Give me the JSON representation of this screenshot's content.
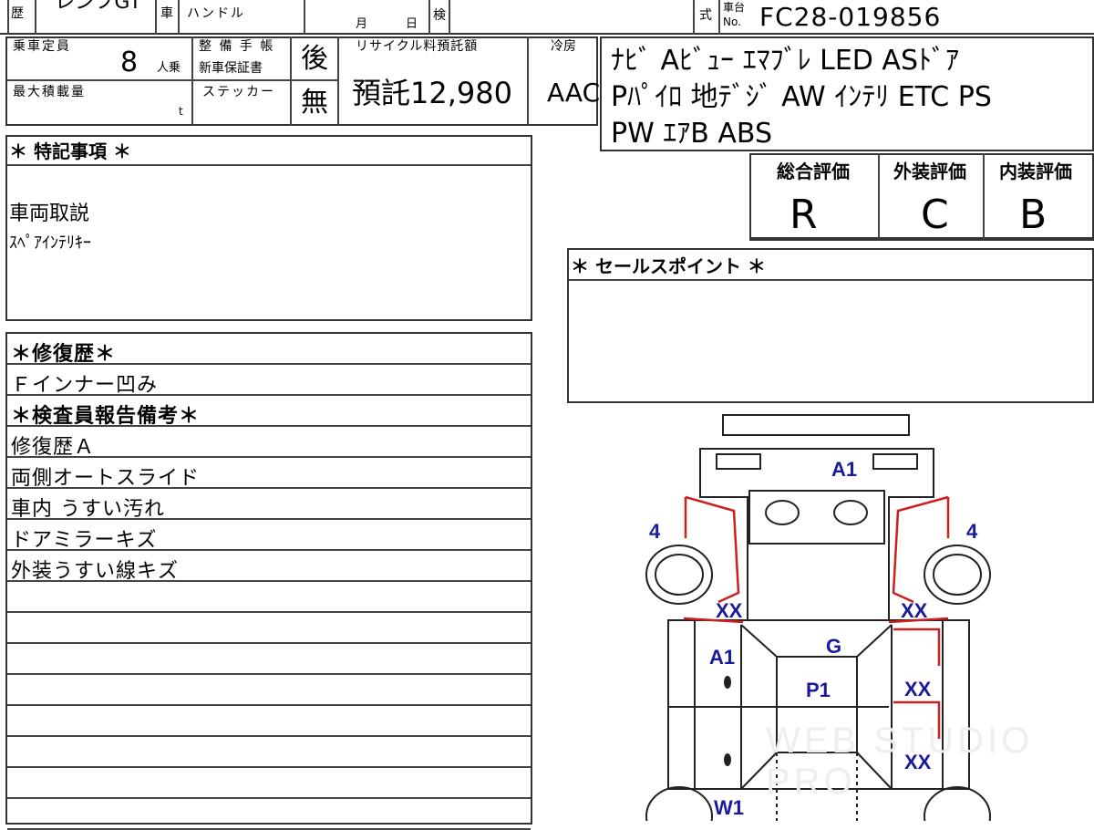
{
  "header": {
    "top_left_fragment": "歴",
    "model_fragment": "レンフGT",
    "car_label": "車",
    "handle_label": "ハンドル",
    "month_label": "月",
    "day_label": "日",
    "inspection_label": "検",
    "type_label": "式",
    "chassis_label_top": "車台",
    "chassis_label_bottom": "No.",
    "chassis_no": "FC28-019856"
  },
  "specs": {
    "capacity_label": "乗車定員",
    "capacity_value": "8",
    "capacity_unit": "人乗",
    "maxload_label": "最大積載量",
    "maxload_unit": "t",
    "maintenance_label": "整 備 手 帳",
    "warranty_label": "新車保証書",
    "sticker_label": "ステッカー",
    "maintenance_value": "後",
    "sticker_value": "無",
    "recycle_label": "リサイクル料預託額",
    "recycle_value": "預託12,980",
    "cooling_label": "冷房",
    "cooling_value": "AAC"
  },
  "equipment": {
    "line1": "ﾅﾋﾞ Aﾋﾞｭｰ ｴﾏﾌﾞﾚ LED ASﾄﾞｱ",
    "line2": "Pﾊﾟｲﾛ 地ﾃﾞｼﾞ AW ｲﾝﾃﾘ ETC PS",
    "line3": "PW ｴｱB ABS"
  },
  "grades": {
    "overall_label": "総合評価",
    "exterior_label": "外装評価",
    "interior_label": "内装評価",
    "overall": "R",
    "exterior": "C",
    "interior": "B"
  },
  "special_notes": {
    "title": "＊ 特記事項 ＊",
    "line1": "車両取説",
    "line2": "ｽﾍﾟｱｲﾝﾃﾘｷｰ"
  },
  "sales_points": {
    "title": "＊ セールスポイント ＊"
  },
  "history": {
    "repair_title": "＊修復歴＊",
    "repair_item": "Ｆインナー凹み",
    "inspector_title": "＊検査員報告備考＊",
    "items": [
      "修復歴Ａ",
      "両側オートスライド",
      "車内 うすい汚れ",
      "ドアミラーキズ",
      "外装うすい線キズ"
    ]
  },
  "diagram_marks": {
    "a1_top": "A1",
    "four_left": "4",
    "four_right": "4",
    "xx_left": "XX",
    "xx_right": "XX",
    "a1_side": "A1",
    "g": "G",
    "p1": "P1",
    "xx_door1": "XX",
    "xx_door2": "XX",
    "w1": "W1"
  },
  "colors": {
    "repair_red": "#cc1f1f",
    "mark_blue": "#1a1a9c"
  },
  "watermark": "WEB STUDIO PRO"
}
